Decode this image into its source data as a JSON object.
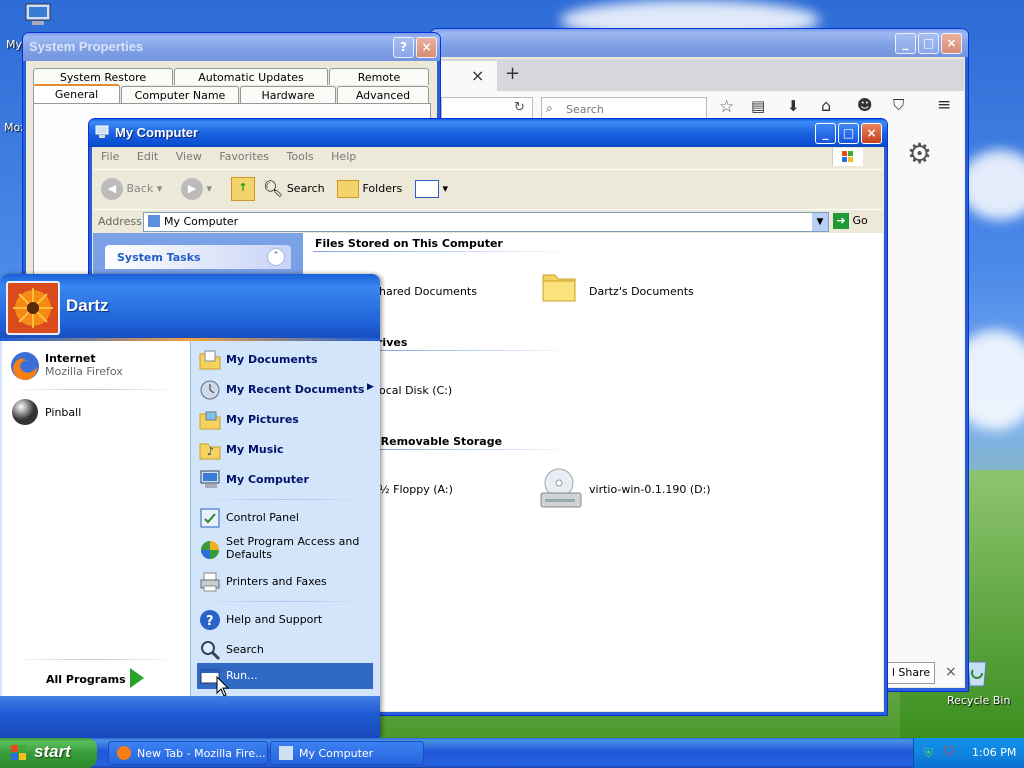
{
  "desktop": {
    "icon_my_label": "My",
    "icon_moz_label": "Moz",
    "recycle_bin_label": "Recycle Bin"
  },
  "system_properties": {
    "title": "System Properties",
    "tabs_row1": [
      "System Restore",
      "Automatic Updates",
      "Remote"
    ],
    "tabs_row2": [
      "General",
      "Computer Name",
      "Hardware",
      "Advanced"
    ],
    "help_btn": "?",
    "close_btn": "×"
  },
  "firefox": {
    "tab_close": "×",
    "new_tab": "+",
    "search_placeholder": "Search",
    "share_button": "l Share",
    "notification_close": "×"
  },
  "explorer": {
    "title": "My Computer",
    "menu": [
      "File",
      "Edit",
      "View",
      "Favorites",
      "Tools",
      "Help"
    ],
    "toolbar": {
      "back": "Back",
      "search": "Search",
      "folders": "Folders"
    },
    "address_label": "Address",
    "address_value": "My Computer",
    "go_label": "Go",
    "system_tasks": "System Tasks",
    "sections": {
      "files": "Files Stored on This Computer",
      "drives": "rives",
      "removable": "h Removable Storage"
    },
    "items": {
      "shared_docs": "hared Documents",
      "dartz_docs": "Dartz's Documents",
      "local_disk": "ocal Disk (C:)",
      "floppy": "½ Floppy (A:)",
      "cd_drive": "virtio-win-0.1.190 (D:)"
    }
  },
  "start_menu": {
    "user_name": "Dartz",
    "left": [
      {
        "title": "Internet",
        "subtitle": "Mozilla Firefox",
        "icon": "firefox-icon"
      },
      {
        "title": "Pinball",
        "subtitle": "",
        "icon": "pinball-icon"
      }
    ],
    "all_programs": "All Programs",
    "right": {
      "my_documents": "My Documents",
      "my_recent_documents": "My Recent Documents",
      "my_pictures": "My Pictures",
      "my_music": "My Music",
      "my_computer": "My Computer",
      "control_panel": "Control Panel",
      "set_program_access_1": "Set Program Access and",
      "set_program_access_2": "Defaults",
      "printers_faxes": "Printers and Faxes",
      "help_support": "Help and Support",
      "search": "Search",
      "run": "Run..."
    }
  },
  "taskbar": {
    "start_label": "start",
    "tasks": [
      "New Tab - Mozilla Fire...",
      "My Computer"
    ],
    "clock": "1:06 PM"
  },
  "colors": {
    "xp_blue": "#0b4fd2",
    "start_green": "#389d38",
    "highlight": "#316ac5"
  }
}
